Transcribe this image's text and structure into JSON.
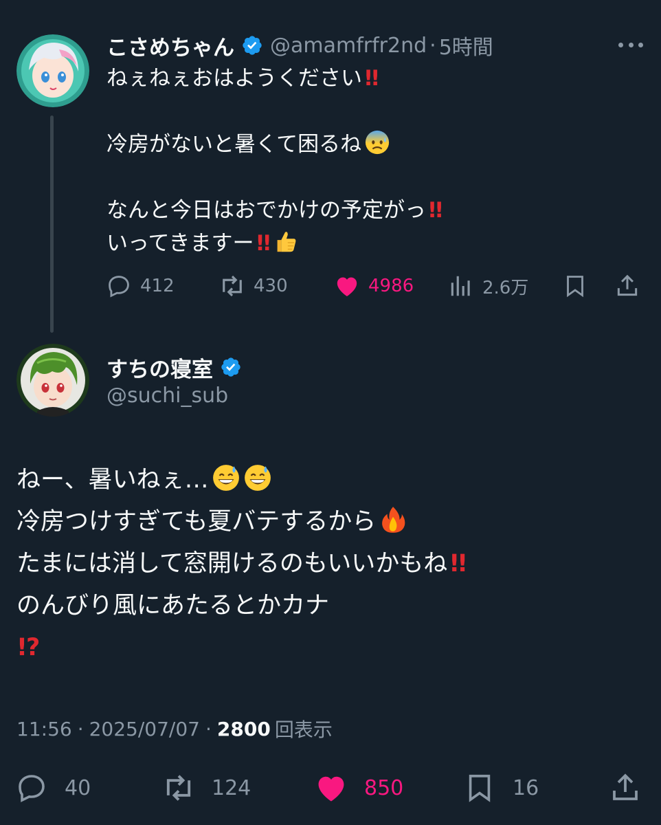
{
  "parent_tweet": {
    "author_name": "こさめちゃん",
    "handle": "@amamfrfr2nd",
    "separator": "·",
    "time": "5時間",
    "lines": [
      "ねぇねぇおはようください",
      "冷房がないと暑くて困るね",
      "なんと今日はおでかけの予定がっ",
      "いってきますー"
    ],
    "replies": "412",
    "reposts": "430",
    "likes": "4986",
    "views": "2.6万"
  },
  "main_tweet": {
    "author_name": "すちの寝室",
    "handle": "@suchi_sub",
    "lines": [
      "ねー、暑いねぇ…",
      "冷房つけすぎても夏バテするから",
      "たまには消して窓開けるのもいいかもね",
      "のんびり風にあたるとかカナ"
    ],
    "time": "11:56",
    "separator": "·",
    "date": "2025/07/07",
    "views_count": "2800",
    "views_label": "回表示",
    "replies": "40",
    "reposts": "124",
    "likes": "850",
    "bookmarks": "16"
  },
  "colors": {
    "background": "#15202b",
    "text": "#f7f9f9",
    "muted": "#8b98a5",
    "like": "#f91880",
    "verified": "#1d9bf0",
    "exclamation": "#e0282f"
  },
  "icons": {
    "verified": "verified-badge-icon",
    "more": "more-dots-icon",
    "reply": "reply-bubble-icon",
    "repost": "repost-arrows-icon",
    "like": "heart-icon",
    "views": "views-chart-icon",
    "bookmark": "bookmark-icon",
    "share": "share-icon",
    "emojis": [
      "double-exclamation",
      "anxious-face-with-sweat",
      "thumbs-up",
      "grinning-face-with-sweat",
      "fire",
      "exclamation-question"
    ]
  }
}
